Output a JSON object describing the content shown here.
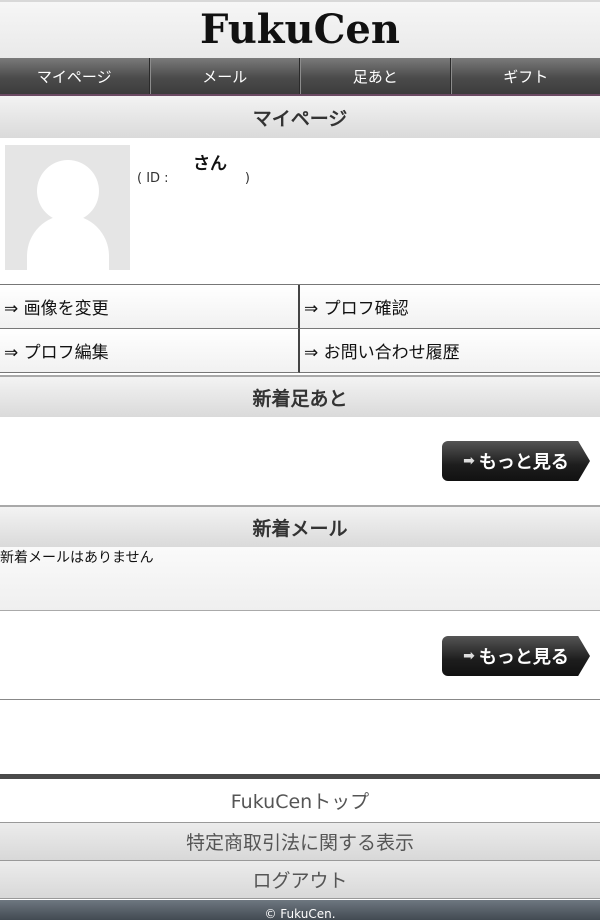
{
  "app": {
    "logo": "FukuCen"
  },
  "nav": [
    {
      "label": "マイページ"
    },
    {
      "label": "メール"
    },
    {
      "label": "足あと"
    },
    {
      "label": "ギフト"
    }
  ],
  "mypage": {
    "heading": "マイページ",
    "username_suffix": "さん",
    "id_prefix": "( ID :",
    "id_value": "",
    "id_suffix": ")"
  },
  "links": [
    {
      "label": "⇒ 画像を変更"
    },
    {
      "label": "⇒ プロフ確認"
    },
    {
      "label": "⇒ プロフ編集"
    },
    {
      "label": "⇒ お問い合わせ履歴"
    }
  ],
  "footprints": {
    "heading": "新着足あと",
    "more_label": "もっと見る"
  },
  "mail": {
    "heading": "新着メール",
    "empty_message": "新着メールはありません",
    "more_label": "もっと見る"
  },
  "footer": {
    "top_link": "FukuCenトップ",
    "legal_link": "特定商取引法に関する表示",
    "logout": "ログアウト",
    "copyright": "© FukuCen."
  },
  "icons": {
    "more_arrow": "arrow-right-icon",
    "avatar": "default-avatar-icon"
  }
}
